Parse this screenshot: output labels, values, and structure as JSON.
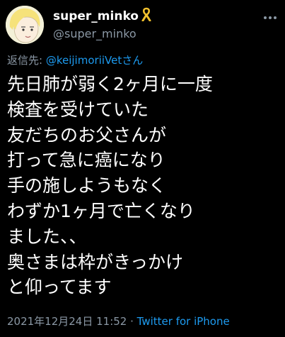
{
  "user": {
    "display_name": "super_minko",
    "badge_icon": "yellow-ribbon-icon",
    "handle": "@super_minko"
  },
  "reply": {
    "prefix": "返信先: ",
    "mention": "@keijimoriiVet",
    "suffix": "さん"
  },
  "tweet": {
    "lines": [
      "先日肺が弱く2ヶ月に一度",
      "検査を受けていた",
      "友だちのお父さんが",
      "打って急に癌になり",
      "手の施しようもなく",
      "わずか1ヶ月で亡くなり",
      "ました、、",
      "奥さまは枠がきっかけ",
      "と仰ってます"
    ]
  },
  "meta": {
    "timestamp": "2021年12月24日 11:52",
    "separator": " · ",
    "source": "Twitter for iPhone"
  },
  "colors": {
    "background": "#000000",
    "text": "#ffffff",
    "secondary_text": "#8b98a5",
    "link": "#1d9bf0",
    "ribbon": "#f2c12e"
  }
}
